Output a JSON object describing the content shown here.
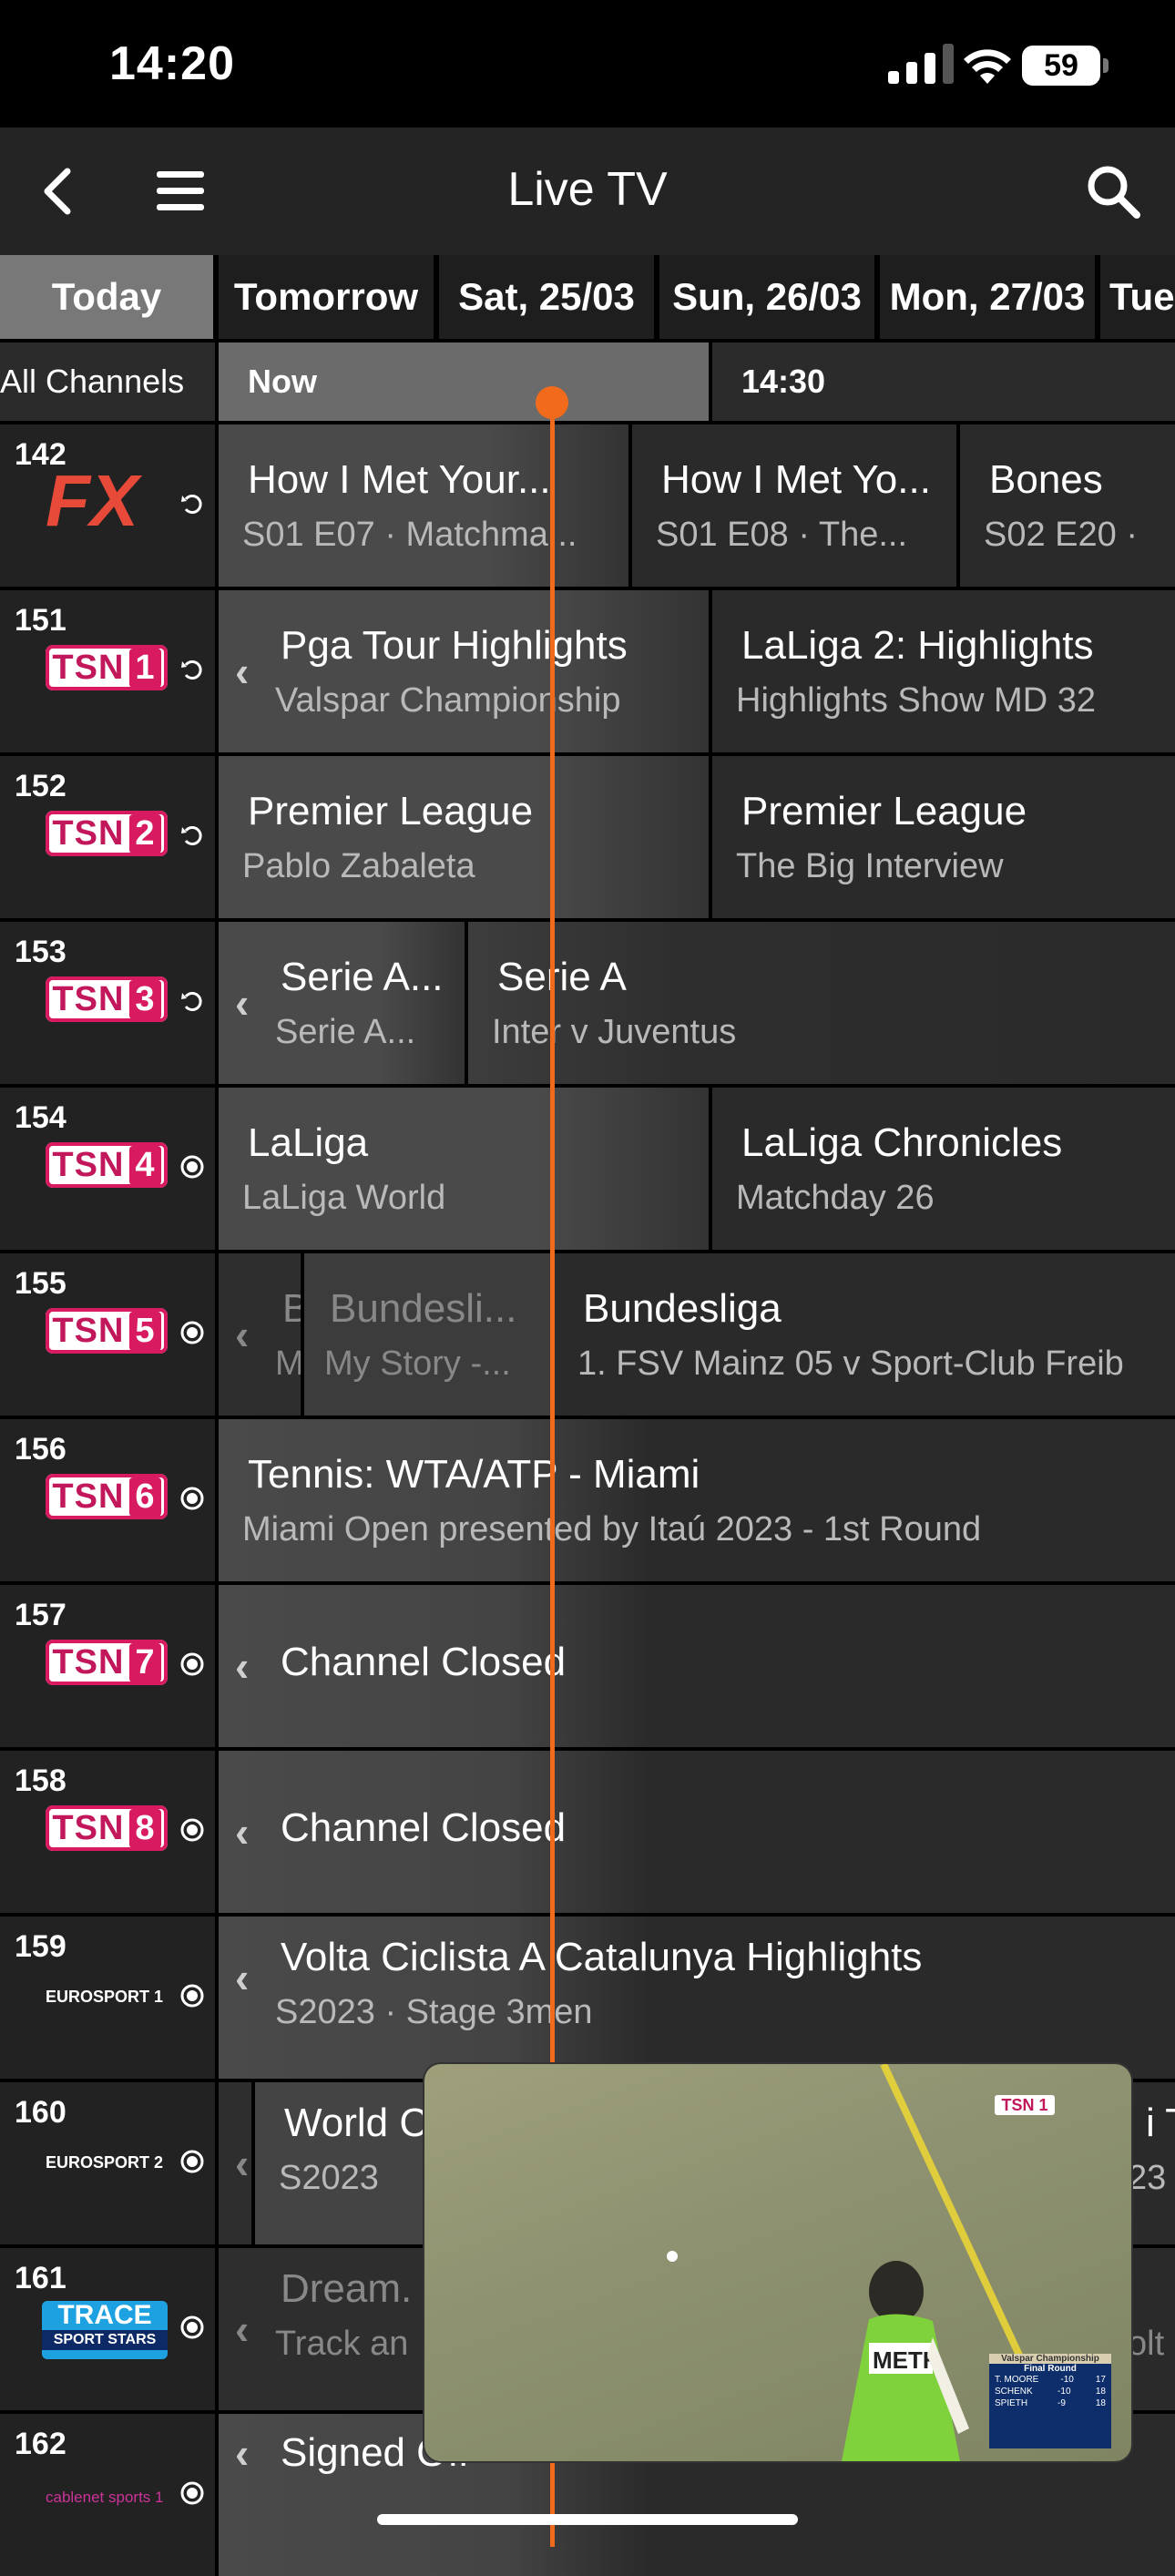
{
  "status_bar": {
    "time": "14:20",
    "battery": "59"
  },
  "header": {
    "title": "Live TV"
  },
  "date_tabs": [
    {
      "label": "Today",
      "active": true
    },
    {
      "label": "Tomorrow"
    },
    {
      "label": "Sat, 25/03"
    },
    {
      "label": "Sun, 26/03"
    },
    {
      "label": "Mon, 27/03"
    },
    {
      "label": "Tue"
    }
  ],
  "timeline": {
    "filter": "All Channels",
    "now": "Now",
    "next": "14:30"
  },
  "channels": [
    {
      "number": "142",
      "logo": "FX",
      "icon": "replay",
      "programs": [
        {
          "title": "How I Met Your...",
          "sub": "S01 E07 · Matchma..."
        },
        {
          "title": "How I Met Yo...",
          "sub": "S01 E08 · The..."
        },
        {
          "title": "Bones",
          "sub": "S02 E20 ·"
        }
      ]
    },
    {
      "number": "151",
      "logo": "TSN",
      "logo_num": "1",
      "icon": "replay",
      "programs": [
        {
          "title": "Pga Tour Highlights",
          "sub": "Valspar Championship"
        },
        {
          "title": "LaLiga 2: Highlights",
          "sub": "Highlights Show MD 32"
        }
      ]
    },
    {
      "number": "152",
      "logo": "TSN",
      "logo_num": "2",
      "icon": "replay",
      "programs": [
        {
          "title": "Premier League",
          "sub": "Pablo Zabaleta"
        },
        {
          "title": "Premier League",
          "sub": "The Big Interview"
        }
      ]
    },
    {
      "number": "153",
      "logo": "TSN",
      "logo_num": "3",
      "icon": "replay",
      "programs": [
        {
          "title": "Serie A...",
          "sub": "Serie A..."
        },
        {
          "title": "Serie A",
          "sub": "Inter v Juventus"
        }
      ]
    },
    {
      "number": "154",
      "logo": "TSN",
      "logo_num": "4",
      "icon": "record",
      "programs": [
        {
          "title": "LaLiga",
          "sub": "LaLiga World"
        },
        {
          "title": "LaLiga Chronicles",
          "sub": "Matchday 26"
        }
      ]
    },
    {
      "number": "155",
      "logo": "TSN",
      "logo_num": "5",
      "icon": "record",
      "programs": [
        {
          "title": "B",
          "sub": "M"
        },
        {
          "title": "Bundesli...",
          "sub": "My Story -..."
        },
        {
          "title": "Bundesliga",
          "sub": "1. FSV Mainz 05 v Sport-Club Freib"
        }
      ]
    },
    {
      "number": "156",
      "logo": "TSN",
      "logo_num": "6",
      "icon": "record",
      "programs": [
        {
          "title": "Tennis: WTA/ATP - Miami",
          "sub": "Miami Open presented by Itaú 2023 - 1st Round"
        }
      ]
    },
    {
      "number": "157",
      "logo": "TSN",
      "logo_num": "7",
      "icon": "record",
      "programs": [
        {
          "title": "Channel Closed",
          "sub": ""
        }
      ]
    },
    {
      "number": "158",
      "logo": "TSN",
      "logo_num": "8",
      "icon": "record",
      "programs": [
        {
          "title": "Channel Closed",
          "sub": ""
        }
      ]
    },
    {
      "number": "159",
      "logo": "EUROSPORT 1",
      "icon": "record",
      "programs": [
        {
          "title": "Volta Ciclista A Catalunya Highlights",
          "sub": "S2023 · Stage 3men"
        }
      ]
    },
    {
      "number": "160",
      "logo": "EUROSPORT 2",
      "icon": "record",
      "programs": [
        {
          "title": "World C",
          "sub": "S2023"
        },
        {
          "title": "i Ta",
          "sub": "23"
        }
      ]
    },
    {
      "number": "161",
      "logo": "TRACE",
      "logo_sub": "SPORT STARS",
      "icon": "record",
      "programs": [
        {
          "title": "Dream.",
          "sub": "Track an"
        },
        {
          "title": "",
          "sub": "olt"
        }
      ]
    },
    {
      "number": "162",
      "logo": "cablenet sports 1",
      "icon": "record",
      "programs": [
        {
          "title": "Signed Off",
          "sub": ""
        }
      ]
    }
  ],
  "pip": {
    "channel_bug": "TSN 1",
    "scoreboard_title": "Valspar Championship",
    "scoreboard_sub": "Final Round",
    "scoreboard_rows": [
      {
        "name": "T. MOORE",
        "score": "-10",
        "thru": "17"
      },
      {
        "name": "SCHENK",
        "score": "-10",
        "thru": "18"
      },
      {
        "name": "SPIETH",
        "score": "-9",
        "thru": "18"
      }
    ],
    "bib": "METH"
  }
}
